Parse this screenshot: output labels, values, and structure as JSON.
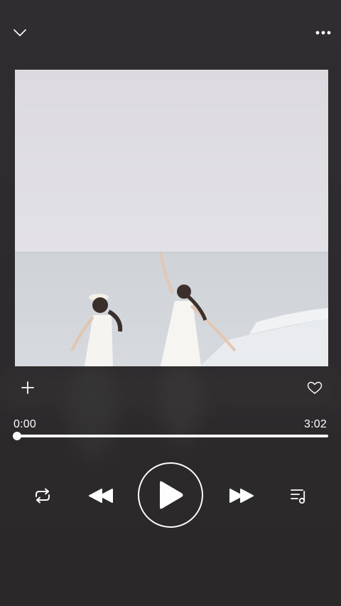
{
  "player": {
    "current_time": "0:00",
    "total_time": "3:02",
    "progress": 0
  },
  "icons": {
    "collapse": "chevron-down-icon",
    "more": "more-horizontal-icon",
    "add": "plus-icon",
    "like": "heart-outline-icon",
    "repeat": "repeat-icon",
    "previous": "skip-previous-icon",
    "play": "play-icon",
    "next": "skip-next-icon",
    "queue": "queue-music-icon"
  },
  "colors": {
    "background": "#2e2c2d",
    "foreground": "#ffffff",
    "progress_track": "#ffffff"
  }
}
